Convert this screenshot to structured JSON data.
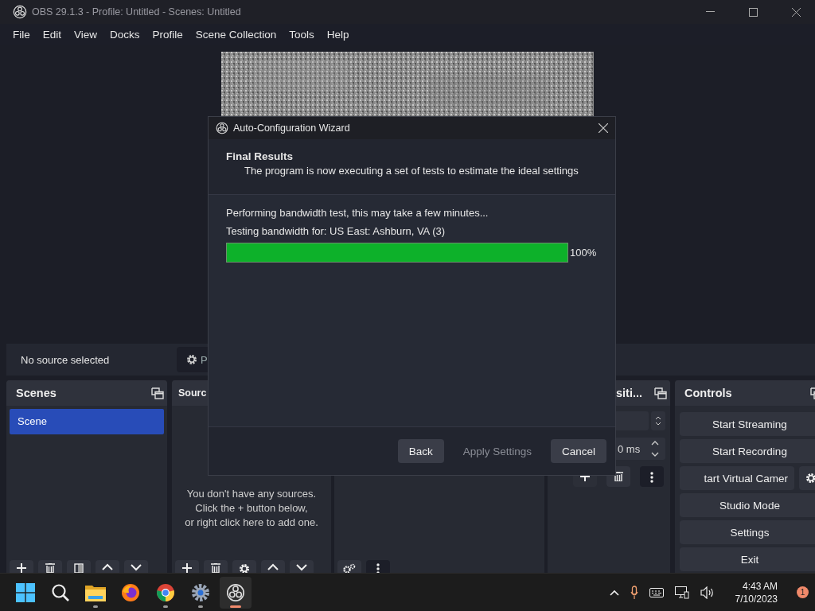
{
  "window": {
    "title": "OBS 29.1.3 - Profile: Untitled - Scenes: Untitled"
  },
  "menu": [
    "File",
    "Edit",
    "View",
    "Docks",
    "Profile",
    "Scene Collection",
    "Tools",
    "Help"
  ],
  "source_toolbar": {
    "status": "No source selected",
    "properties_button": "P"
  },
  "docks": [
    {
      "kind": "scenes",
      "title": "Scenes",
      "items": [
        {
          "label": "Scene",
          "selected": true
        }
      ]
    },
    {
      "kind": "sources",
      "title": "Sourc",
      "empty_message": "You don't have any sources.\nClick the + button below,\nor right click here to add one."
    },
    {
      "kind": "mixer"
    },
    {
      "kind": "transitions",
      "title": "siti...",
      "duration": "0 ms"
    },
    {
      "kind": "controls",
      "title": "Controls",
      "buttons": [
        {
          "label": "Start Streaming",
          "kind": "button"
        },
        {
          "label": "Start Recording",
          "kind": "button"
        },
        {
          "label": "tart Virtual Camer",
          "kind": "split"
        },
        {
          "label": "Studio Mode",
          "kind": "button"
        },
        {
          "label": "Settings",
          "kind": "button"
        },
        {
          "label": "Exit",
          "kind": "button"
        }
      ]
    }
  ],
  "dialog": {
    "title": "Auto-Configuration Wizard",
    "heading": "Final Results",
    "subtitle": "The program is now executing a set of tests to estimate the ideal settings",
    "status": "Performing bandwidth test, this may take a few minutes...",
    "server": "Testing bandwidth for: US East: Ashburn, VA (3)",
    "progress": {
      "level": 1,
      "reading": "100%"
    },
    "buttons": [
      {
        "label": "Back",
        "disabled": false
      },
      {
        "label": "Apply Settings",
        "disabled": true
      },
      {
        "label": "Cancel",
        "disabled": false
      }
    ]
  },
  "taskbar": {
    "apps": [
      {
        "kind": "start",
        "running": false,
        "selected": false
      },
      {
        "kind": "search",
        "running": false,
        "selected": false
      },
      {
        "kind": "folder",
        "running": true,
        "selected": false
      },
      {
        "kind": "firefox",
        "running": false,
        "selected": false
      },
      {
        "kind": "chrome",
        "running": true,
        "selected": false
      },
      {
        "kind": "settings",
        "running": true,
        "selected": false
      },
      {
        "kind": "obs",
        "running": true,
        "selected": true
      }
    ],
    "time": "4:43 AM",
    "date": "7/10/2023",
    "notifications": "1"
  }
}
